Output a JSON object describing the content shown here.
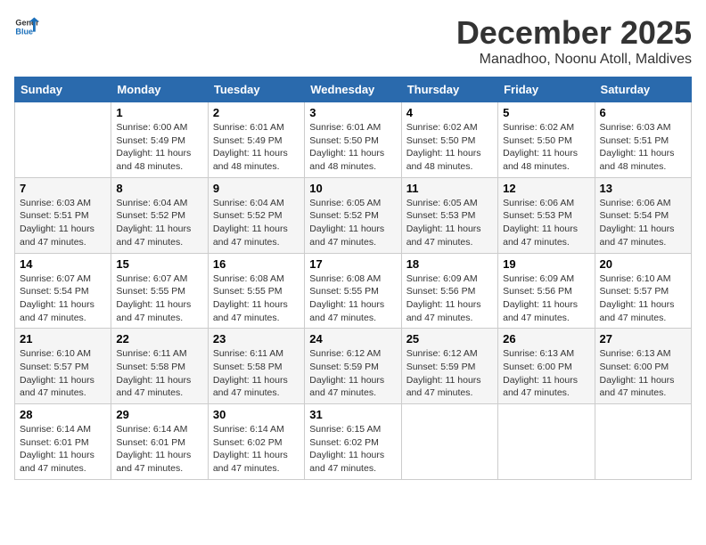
{
  "header": {
    "logo_general": "General",
    "logo_blue": "Blue",
    "month_title": "December 2025",
    "location": "Manadhoo, Noonu Atoll, Maldives"
  },
  "days_of_week": [
    "Sunday",
    "Monday",
    "Tuesday",
    "Wednesday",
    "Thursday",
    "Friday",
    "Saturday"
  ],
  "weeks": [
    [
      {
        "day": "",
        "sunrise": "",
        "sunset": "",
        "daylight": ""
      },
      {
        "day": "1",
        "sunrise": "Sunrise: 6:00 AM",
        "sunset": "Sunset: 5:49 PM",
        "daylight": "Daylight: 11 hours and 48 minutes."
      },
      {
        "day": "2",
        "sunrise": "Sunrise: 6:01 AM",
        "sunset": "Sunset: 5:49 PM",
        "daylight": "Daylight: 11 hours and 48 minutes."
      },
      {
        "day": "3",
        "sunrise": "Sunrise: 6:01 AM",
        "sunset": "Sunset: 5:50 PM",
        "daylight": "Daylight: 11 hours and 48 minutes."
      },
      {
        "day": "4",
        "sunrise": "Sunrise: 6:02 AM",
        "sunset": "Sunset: 5:50 PM",
        "daylight": "Daylight: 11 hours and 48 minutes."
      },
      {
        "day": "5",
        "sunrise": "Sunrise: 6:02 AM",
        "sunset": "Sunset: 5:50 PM",
        "daylight": "Daylight: 11 hours and 48 minutes."
      },
      {
        "day": "6",
        "sunrise": "Sunrise: 6:03 AM",
        "sunset": "Sunset: 5:51 PM",
        "daylight": "Daylight: 11 hours and 48 minutes."
      }
    ],
    [
      {
        "day": "7",
        "sunrise": "Sunrise: 6:03 AM",
        "sunset": "Sunset: 5:51 PM",
        "daylight": "Daylight: 11 hours and 47 minutes."
      },
      {
        "day": "8",
        "sunrise": "Sunrise: 6:04 AM",
        "sunset": "Sunset: 5:52 PM",
        "daylight": "Daylight: 11 hours and 47 minutes."
      },
      {
        "day": "9",
        "sunrise": "Sunrise: 6:04 AM",
        "sunset": "Sunset: 5:52 PM",
        "daylight": "Daylight: 11 hours and 47 minutes."
      },
      {
        "day": "10",
        "sunrise": "Sunrise: 6:05 AM",
        "sunset": "Sunset: 5:52 PM",
        "daylight": "Daylight: 11 hours and 47 minutes."
      },
      {
        "day": "11",
        "sunrise": "Sunrise: 6:05 AM",
        "sunset": "Sunset: 5:53 PM",
        "daylight": "Daylight: 11 hours and 47 minutes."
      },
      {
        "day": "12",
        "sunrise": "Sunrise: 6:06 AM",
        "sunset": "Sunset: 5:53 PM",
        "daylight": "Daylight: 11 hours and 47 minutes."
      },
      {
        "day": "13",
        "sunrise": "Sunrise: 6:06 AM",
        "sunset": "Sunset: 5:54 PM",
        "daylight": "Daylight: 11 hours and 47 minutes."
      }
    ],
    [
      {
        "day": "14",
        "sunrise": "Sunrise: 6:07 AM",
        "sunset": "Sunset: 5:54 PM",
        "daylight": "Daylight: 11 hours and 47 minutes."
      },
      {
        "day": "15",
        "sunrise": "Sunrise: 6:07 AM",
        "sunset": "Sunset: 5:55 PM",
        "daylight": "Daylight: 11 hours and 47 minutes."
      },
      {
        "day": "16",
        "sunrise": "Sunrise: 6:08 AM",
        "sunset": "Sunset: 5:55 PM",
        "daylight": "Daylight: 11 hours and 47 minutes."
      },
      {
        "day": "17",
        "sunrise": "Sunrise: 6:08 AM",
        "sunset": "Sunset: 5:55 PM",
        "daylight": "Daylight: 11 hours and 47 minutes."
      },
      {
        "day": "18",
        "sunrise": "Sunrise: 6:09 AM",
        "sunset": "Sunset: 5:56 PM",
        "daylight": "Daylight: 11 hours and 47 minutes."
      },
      {
        "day": "19",
        "sunrise": "Sunrise: 6:09 AM",
        "sunset": "Sunset: 5:56 PM",
        "daylight": "Daylight: 11 hours and 47 minutes."
      },
      {
        "day": "20",
        "sunrise": "Sunrise: 6:10 AM",
        "sunset": "Sunset: 5:57 PM",
        "daylight": "Daylight: 11 hours and 47 minutes."
      }
    ],
    [
      {
        "day": "21",
        "sunrise": "Sunrise: 6:10 AM",
        "sunset": "Sunset: 5:57 PM",
        "daylight": "Daylight: 11 hours and 47 minutes."
      },
      {
        "day": "22",
        "sunrise": "Sunrise: 6:11 AM",
        "sunset": "Sunset: 5:58 PM",
        "daylight": "Daylight: 11 hours and 47 minutes."
      },
      {
        "day": "23",
        "sunrise": "Sunrise: 6:11 AM",
        "sunset": "Sunset: 5:58 PM",
        "daylight": "Daylight: 11 hours and 47 minutes."
      },
      {
        "day": "24",
        "sunrise": "Sunrise: 6:12 AM",
        "sunset": "Sunset: 5:59 PM",
        "daylight": "Daylight: 11 hours and 47 minutes."
      },
      {
        "day": "25",
        "sunrise": "Sunrise: 6:12 AM",
        "sunset": "Sunset: 5:59 PM",
        "daylight": "Daylight: 11 hours and 47 minutes."
      },
      {
        "day": "26",
        "sunrise": "Sunrise: 6:13 AM",
        "sunset": "Sunset: 6:00 PM",
        "daylight": "Daylight: 11 hours and 47 minutes."
      },
      {
        "day": "27",
        "sunrise": "Sunrise: 6:13 AM",
        "sunset": "Sunset: 6:00 PM",
        "daylight": "Daylight: 11 hours and 47 minutes."
      }
    ],
    [
      {
        "day": "28",
        "sunrise": "Sunrise: 6:14 AM",
        "sunset": "Sunset: 6:01 PM",
        "daylight": "Daylight: 11 hours and 47 minutes."
      },
      {
        "day": "29",
        "sunrise": "Sunrise: 6:14 AM",
        "sunset": "Sunset: 6:01 PM",
        "daylight": "Daylight: 11 hours and 47 minutes."
      },
      {
        "day": "30",
        "sunrise": "Sunrise: 6:14 AM",
        "sunset": "Sunset: 6:02 PM",
        "daylight": "Daylight: 11 hours and 47 minutes."
      },
      {
        "day": "31",
        "sunrise": "Sunrise: 6:15 AM",
        "sunset": "Sunset: 6:02 PM",
        "daylight": "Daylight: 11 hours and 47 minutes."
      },
      {
        "day": "",
        "sunrise": "",
        "sunset": "",
        "daylight": ""
      },
      {
        "day": "",
        "sunrise": "",
        "sunset": "",
        "daylight": ""
      },
      {
        "day": "",
        "sunrise": "",
        "sunset": "",
        "daylight": ""
      }
    ]
  ]
}
